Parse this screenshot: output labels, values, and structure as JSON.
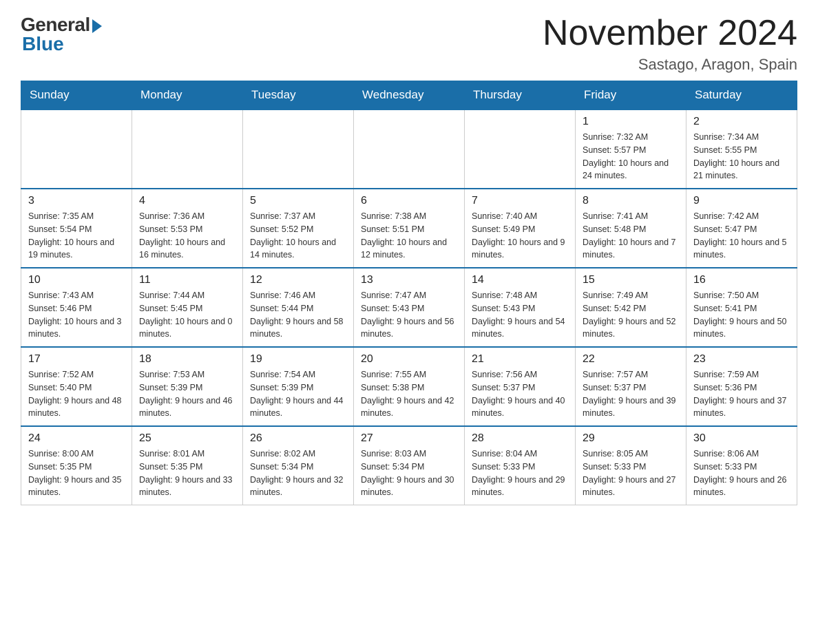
{
  "logo": {
    "general": "General",
    "blue": "Blue"
  },
  "header": {
    "month_year": "November 2024",
    "location": "Sastago, Aragon, Spain"
  },
  "weekdays": [
    "Sunday",
    "Monday",
    "Tuesday",
    "Wednesday",
    "Thursday",
    "Friday",
    "Saturday"
  ],
  "weeks": [
    [
      {
        "day": "",
        "info": ""
      },
      {
        "day": "",
        "info": ""
      },
      {
        "day": "",
        "info": ""
      },
      {
        "day": "",
        "info": ""
      },
      {
        "day": "",
        "info": ""
      },
      {
        "day": "1",
        "info": "Sunrise: 7:32 AM\nSunset: 5:57 PM\nDaylight: 10 hours and 24 minutes."
      },
      {
        "day": "2",
        "info": "Sunrise: 7:34 AM\nSunset: 5:55 PM\nDaylight: 10 hours and 21 minutes."
      }
    ],
    [
      {
        "day": "3",
        "info": "Sunrise: 7:35 AM\nSunset: 5:54 PM\nDaylight: 10 hours and 19 minutes."
      },
      {
        "day": "4",
        "info": "Sunrise: 7:36 AM\nSunset: 5:53 PM\nDaylight: 10 hours and 16 minutes."
      },
      {
        "day": "5",
        "info": "Sunrise: 7:37 AM\nSunset: 5:52 PM\nDaylight: 10 hours and 14 minutes."
      },
      {
        "day": "6",
        "info": "Sunrise: 7:38 AM\nSunset: 5:51 PM\nDaylight: 10 hours and 12 minutes."
      },
      {
        "day": "7",
        "info": "Sunrise: 7:40 AM\nSunset: 5:49 PM\nDaylight: 10 hours and 9 minutes."
      },
      {
        "day": "8",
        "info": "Sunrise: 7:41 AM\nSunset: 5:48 PM\nDaylight: 10 hours and 7 minutes."
      },
      {
        "day": "9",
        "info": "Sunrise: 7:42 AM\nSunset: 5:47 PM\nDaylight: 10 hours and 5 minutes."
      }
    ],
    [
      {
        "day": "10",
        "info": "Sunrise: 7:43 AM\nSunset: 5:46 PM\nDaylight: 10 hours and 3 minutes."
      },
      {
        "day": "11",
        "info": "Sunrise: 7:44 AM\nSunset: 5:45 PM\nDaylight: 10 hours and 0 minutes."
      },
      {
        "day": "12",
        "info": "Sunrise: 7:46 AM\nSunset: 5:44 PM\nDaylight: 9 hours and 58 minutes."
      },
      {
        "day": "13",
        "info": "Sunrise: 7:47 AM\nSunset: 5:43 PM\nDaylight: 9 hours and 56 minutes."
      },
      {
        "day": "14",
        "info": "Sunrise: 7:48 AM\nSunset: 5:43 PM\nDaylight: 9 hours and 54 minutes."
      },
      {
        "day": "15",
        "info": "Sunrise: 7:49 AM\nSunset: 5:42 PM\nDaylight: 9 hours and 52 minutes."
      },
      {
        "day": "16",
        "info": "Sunrise: 7:50 AM\nSunset: 5:41 PM\nDaylight: 9 hours and 50 minutes."
      }
    ],
    [
      {
        "day": "17",
        "info": "Sunrise: 7:52 AM\nSunset: 5:40 PM\nDaylight: 9 hours and 48 minutes."
      },
      {
        "day": "18",
        "info": "Sunrise: 7:53 AM\nSunset: 5:39 PM\nDaylight: 9 hours and 46 minutes."
      },
      {
        "day": "19",
        "info": "Sunrise: 7:54 AM\nSunset: 5:39 PM\nDaylight: 9 hours and 44 minutes."
      },
      {
        "day": "20",
        "info": "Sunrise: 7:55 AM\nSunset: 5:38 PM\nDaylight: 9 hours and 42 minutes."
      },
      {
        "day": "21",
        "info": "Sunrise: 7:56 AM\nSunset: 5:37 PM\nDaylight: 9 hours and 40 minutes."
      },
      {
        "day": "22",
        "info": "Sunrise: 7:57 AM\nSunset: 5:37 PM\nDaylight: 9 hours and 39 minutes."
      },
      {
        "day": "23",
        "info": "Sunrise: 7:59 AM\nSunset: 5:36 PM\nDaylight: 9 hours and 37 minutes."
      }
    ],
    [
      {
        "day": "24",
        "info": "Sunrise: 8:00 AM\nSunset: 5:35 PM\nDaylight: 9 hours and 35 minutes."
      },
      {
        "day": "25",
        "info": "Sunrise: 8:01 AM\nSunset: 5:35 PM\nDaylight: 9 hours and 33 minutes."
      },
      {
        "day": "26",
        "info": "Sunrise: 8:02 AM\nSunset: 5:34 PM\nDaylight: 9 hours and 32 minutes."
      },
      {
        "day": "27",
        "info": "Sunrise: 8:03 AM\nSunset: 5:34 PM\nDaylight: 9 hours and 30 minutes."
      },
      {
        "day": "28",
        "info": "Sunrise: 8:04 AM\nSunset: 5:33 PM\nDaylight: 9 hours and 29 minutes."
      },
      {
        "day": "29",
        "info": "Sunrise: 8:05 AM\nSunset: 5:33 PM\nDaylight: 9 hours and 27 minutes."
      },
      {
        "day": "30",
        "info": "Sunrise: 8:06 AM\nSunset: 5:33 PM\nDaylight: 9 hours and 26 minutes."
      }
    ]
  ]
}
